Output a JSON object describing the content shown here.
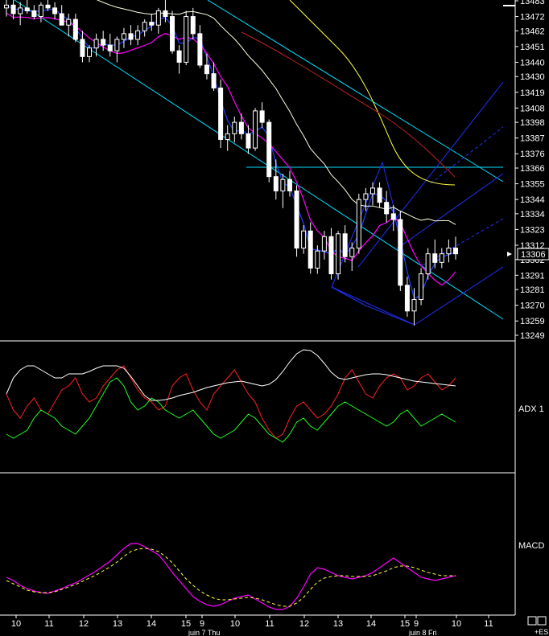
{
  "colors": {
    "background": "#000000",
    "grid": "#ffffff",
    "candle_up": "#ffffff",
    "candle_down": "#ffffff",
    "ma_fast": "#2040ff",
    "ma_slow": "#ff00ff",
    "ma_long_yellow": "#ffff40",
    "ma_long_red": "#c02020",
    "ma_white": "#ffffe0",
    "channel_cyan": "#00e0ff",
    "channel_blue": "#2030ff",
    "adx_plus": "#ff2020",
    "adx_minus": "#20ff20",
    "adx_white": "#ffffff",
    "macd_line": "#ff00ff",
    "macd_signal": "#ffff40"
  },
  "price_axis": {
    "ticks": [
      "13483",
      "13472",
      "13462",
      "13451",
      "13440",
      "13430",
      "13419",
      "13408",
      "13398",
      "13387",
      "13376",
      "13366",
      "13355",
      "13344",
      "13334",
      "13323",
      "13312",
      "13302",
      "13291",
      "13281",
      "13270",
      "13259",
      "13249"
    ],
    "current_price": "13306",
    "ylim": [
      13249,
      13483
    ]
  },
  "time_axis": {
    "ticks": [
      "10",
      "11",
      "12",
      "13",
      "14",
      "15",
      "9",
      "10",
      "11",
      "12",
      "13",
      "14",
      "15",
      "9",
      "10",
      "11"
    ],
    "dates": [
      "juin 7 Thu",
      "juin 8 Fri"
    ]
  },
  "panes": {
    "adx_label": "ADX  1",
    "macd_label": "MACD",
    "es_label": "+ES"
  },
  "chart_data": {
    "type": "line",
    "title": "",
    "candles": [
      [
        13478,
        13485,
        13472,
        13480
      ],
      [
        13480,
        13486,
        13470,
        13474
      ],
      [
        13474,
        13482,
        13466,
        13478
      ],
      [
        13478,
        13484,
        13474,
        13476
      ],
      [
        13476,
        13480,
        13470,
        13472
      ],
      [
        13472,
        13482,
        13468,
        13480
      ],
      [
        13480,
        13486,
        13476,
        13478
      ],
      [
        13478,
        13482,
        13470,
        13474
      ],
      [
        13474,
        13480,
        13468,
        13466
      ],
      [
        13466,
        13474,
        13458,
        13470
      ],
      [
        13470,
        13474,
        13454,
        13456
      ],
      [
        13456,
        13462,
        13440,
        13444
      ],
      [
        13444,
        13452,
        13440,
        13450
      ],
      [
        13450,
        13460,
        13444,
        13456
      ],
      [
        13456,
        13462,
        13448,
        13452
      ],
      [
        13452,
        13460,
        13444,
        13448
      ],
      [
        13448,
        13458,
        13440,
        13456
      ],
      [
        13456,
        13464,
        13450,
        13460
      ],
      [
        13460,
        13466,
        13452,
        13456
      ],
      [
        13456,
        13466,
        13452,
        13462
      ],
      [
        13462,
        13470,
        13458,
        13468
      ],
      [
        13468,
        13474,
        13462,
        13466
      ],
      [
        13466,
        13478,
        13460,
        13476
      ],
      [
        13476,
        13484,
        13468,
        13472
      ],
      [
        13472,
        13476,
        13446,
        13448
      ],
      [
        13448,
        13452,
        13432,
        13440
      ],
      [
        13440,
        13476,
        13438,
        13472
      ],
      [
        13472,
        13478,
        13456,
        13460
      ],
      [
        13460,
        13466,
        13436,
        13438
      ],
      [
        13438,
        13446,
        13428,
        13432
      ],
      [
        13432,
        13440,
        13420,
        13422
      ],
      [
        13422,
        13428,
        13380,
        13386
      ],
      [
        13386,
        13396,
        13378,
        13390
      ],
      [
        13390,
        13402,
        13384,
        13398
      ],
      [
        13398,
        13404,
        13386,
        13390
      ],
      [
        13390,
        13396,
        13376,
        13380
      ],
      [
        13380,
        13408,
        13378,
        13406
      ],
      [
        13406,
        13412,
        13394,
        13398
      ],
      [
        13398,
        13400,
        13356,
        13360
      ],
      [
        13360,
        13372,
        13344,
        13350
      ],
      [
        13350,
        13362,
        13338,
        13358
      ],
      [
        13358,
        13364,
        13346,
        13350
      ],
      [
        13350,
        13354,
        13304,
        13310
      ],
      [
        13310,
        13326,
        13306,
        13322
      ],
      [
        13322,
        13328,
        13292,
        13296
      ],
      [
        13296,
        13312,
        13292,
        13308
      ],
      [
        13308,
        13322,
        13302,
        13318
      ],
      [
        13318,
        13324,
        13288,
        13292
      ],
      [
        13292,
        13322,
        13288,
        13320
      ],
      [
        13320,
        13326,
        13300,
        13304
      ],
      [
        13304,
        13314,
        13294,
        13310
      ],
      [
        13310,
        13348,
        13306,
        13344
      ],
      [
        13344,
        13352,
        13336,
        13348
      ],
      [
        13348,
        13356,
        13340,
        13352
      ],
      [
        13352,
        13356,
        13338,
        13342
      ],
      [
        13342,
        13350,
        13328,
        13334
      ],
      [
        13334,
        13340,
        13322,
        13330
      ],
      [
        13330,
        13336,
        13280,
        13284
      ],
      [
        13284,
        13290,
        13262,
        13266
      ],
      [
        13266,
        13282,
        13256,
        13274
      ],
      [
        13274,
        13296,
        13270,
        13292
      ],
      [
        13292,
        13310,
        13288,
        13306
      ],
      [
        13306,
        13316,
        13296,
        13300
      ],
      [
        13300,
        13310,
        13296,
        13306
      ],
      [
        13306,
        13316,
        13300,
        13310
      ],
      [
        13310,
        13318,
        13302,
        13306
      ]
    ],
    "adx_plus": [
      490,
      510,
      520,
      505,
      495,
      510,
      515,
      500,
      485,
      480,
      470,
      490,
      500,
      495,
      480,
      470,
      460,
      455,
      470,
      485,
      495,
      500,
      510,
      505,
      480,
      470,
      465,
      485,
      500,
      510,
      490,
      480,
      470,
      460,
      475,
      490,
      500,
      520,
      535,
      545,
      540,
      520,
      505,
      500,
      510,
      520,
      515,
      505,
      490,
      470,
      460,
      475,
      490,
      495,
      480,
      470,
      465,
      470,
      485,
      480,
      470,
      465,
      475,
      485,
      480,
      470
    ],
    "adx_minus": [
      540,
      545,
      540,
      535,
      520,
      510,
      515,
      520,
      530,
      535,
      540,
      530,
      520,
      505,
      490,
      475,
      470,
      480,
      500,
      510,
      505,
      495,
      500,
      510,
      515,
      520,
      515,
      510,
      520,
      530,
      540,
      545,
      540,
      535,
      525,
      515,
      520,
      530,
      540,
      545,
      550,
      540,
      525,
      520,
      530,
      535,
      525,
      515,
      505,
      500,
      505,
      510,
      515,
      520,
      525,
      530,
      525,
      515,
      510,
      520,
      530,
      525,
      520,
      515,
      520,
      525
    ],
    "adx_white": [
      490,
      470,
      460,
      455,
      455,
      460,
      465,
      470,
      470,
      465,
      465,
      465,
      462,
      458,
      455,
      455,
      455,
      458,
      468,
      480,
      492,
      498,
      498,
      497,
      495,
      492,
      490,
      488,
      485,
      482,
      480,
      478,
      476,
      475,
      474,
      476,
      478,
      480,
      478,
      472,
      462,
      450,
      440,
      435,
      436,
      442,
      452,
      463,
      470,
      472,
      470,
      468,
      466,
      465,
      465,
      466,
      468,
      470,
      472,
      474,
      475,
      476,
      477,
      478,
      479,
      480
    ],
    "macd": [
      718,
      722,
      728,
      732,
      735,
      737,
      738,
      735,
      732,
      728,
      725,
      720,
      715,
      710,
      704,
      698,
      690,
      682,
      676,
      676,
      680,
      685,
      690,
      700,
      712,
      722,
      732,
      742,
      748,
      752,
      754,
      752,
      748,
      744,
      742,
      740,
      745,
      750,
      755,
      758,
      758,
      754,
      744,
      730,
      714,
      706,
      708,
      712,
      716,
      718,
      720,
      718,
      716,
      712,
      706,
      700,
      694,
      700,
      706,
      712,
      718,
      720,
      722,
      720,
      718,
      716
    ],
    "macd_signal": [
      722,
      726,
      730,
      734,
      736,
      737,
      737,
      736,
      733,
      730,
      727,
      723,
      719,
      715,
      710,
      705,
      699,
      692,
      686,
      683,
      682,
      683,
      686,
      692,
      700,
      710,
      720,
      728,
      735,
      740,
      744,
      746,
      746,
      745,
      744,
      743,
      744,
      746,
      749,
      752,
      754,
      754,
      750,
      743,
      733,
      724,
      719,
      717,
      716,
      716,
      717,
      717,
      717,
      716,
      713,
      710,
      706,
      704,
      704,
      706,
      709,
      712,
      714,
      716,
      716,
      716
    ]
  }
}
